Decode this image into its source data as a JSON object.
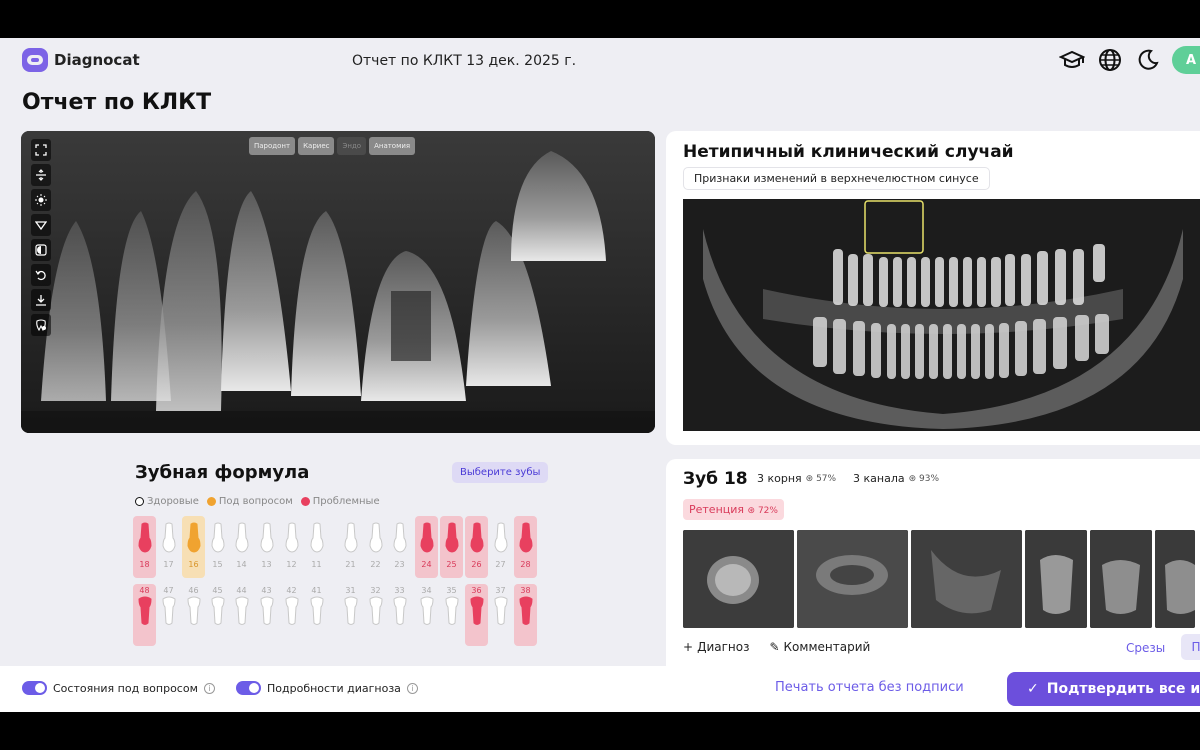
{
  "header": {
    "logo_text": "Diagnocat",
    "title": "Отчет по КЛКТ 13 дек. 2025 г.",
    "avatar_letter": "A",
    "icons": [
      "graduation-cap-icon",
      "globe-icon",
      "moon-icon"
    ]
  },
  "page_title": "Отчет по КЛКТ",
  "viewer": {
    "tools": [
      "expand-icon",
      "split-icon",
      "brightness-icon",
      "triangle-down-icon",
      "contrast-icon",
      "undo-icon",
      "download-icon",
      "tooth-settings-icon"
    ],
    "filters": [
      {
        "label": "Пародонт",
        "active": true
      },
      {
        "label": "Кариес",
        "active": true
      },
      {
        "label": "Эндо",
        "active": false
      },
      {
        "label": "Анатомия",
        "active": true
      }
    ]
  },
  "formula": {
    "title": "Зубная формула",
    "select_button": "Выберите зубы",
    "legend": [
      {
        "label": "Здоровые",
        "color": "#ffffff"
      },
      {
        "label": "Под вопросом",
        "color": "#f0a330"
      },
      {
        "label": "Проблемные",
        "color": "#e8405f"
      }
    ],
    "upper": [
      {
        "n": "18",
        "s": "problem"
      },
      {
        "n": "17",
        "s": "healthy"
      },
      {
        "n": "16",
        "s": "question"
      },
      {
        "n": "15",
        "s": "healthy"
      },
      {
        "n": "14",
        "s": "healthy"
      },
      {
        "n": "13",
        "s": "healthy"
      },
      {
        "n": "12",
        "s": "healthy"
      },
      {
        "n": "11",
        "s": "healthy"
      },
      {
        "n": "21",
        "s": "healthy"
      },
      {
        "n": "22",
        "s": "healthy"
      },
      {
        "n": "23",
        "s": "healthy"
      },
      {
        "n": "24",
        "s": "problem"
      },
      {
        "n": "25",
        "s": "problem"
      },
      {
        "n": "26",
        "s": "problem"
      },
      {
        "n": "27",
        "s": "healthy"
      },
      {
        "n": "28",
        "s": "problem"
      }
    ],
    "lower": [
      {
        "n": "48",
        "s": "problem"
      },
      {
        "n": "47",
        "s": "healthy"
      },
      {
        "n": "46",
        "s": "healthy"
      },
      {
        "n": "45",
        "s": "healthy"
      },
      {
        "n": "44",
        "s": "healthy"
      },
      {
        "n": "43",
        "s": "healthy"
      },
      {
        "n": "42",
        "s": "healthy"
      },
      {
        "n": "41",
        "s": "healthy"
      },
      {
        "n": "31",
        "s": "healthy"
      },
      {
        "n": "32",
        "s": "healthy"
      },
      {
        "n": "33",
        "s": "healthy"
      },
      {
        "n": "34",
        "s": "healthy"
      },
      {
        "n": "35",
        "s": "healthy"
      },
      {
        "n": "36",
        "s": "problem"
      },
      {
        "n": "37",
        "s": "healthy"
      },
      {
        "n": "38",
        "s": "problem"
      }
    ]
  },
  "case_card": {
    "title": "Нетипичный клинический случай",
    "chip": "Признаки изменений в верхнечелюстном синусе"
  },
  "tooth_card": {
    "title": "Зуб 18",
    "chips": [
      {
        "label": "3 корня",
        "pct": "57%"
      },
      {
        "label": "3 канала",
        "pct": "93%"
      }
    ],
    "retention_label": "Ретенция",
    "retention_pct": "72%",
    "diagnosis_action": "Диагноз",
    "comment_action": "Комментарий",
    "slices_link": "Срезы",
    "p_button": "П"
  },
  "bottom": {
    "toggle1": "Состояния под вопросом",
    "toggle2": "Подробности диагноза",
    "print_link": "Печать отчета без подписи",
    "confirm_button": "Подтвердить все и"
  }
}
